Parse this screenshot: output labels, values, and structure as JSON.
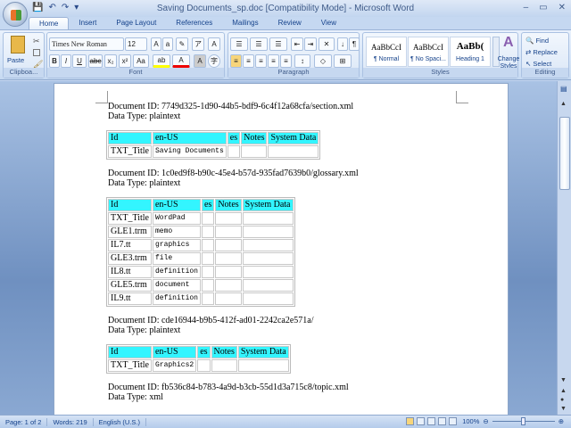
{
  "window": {
    "title": "Saving Documents_sp.doc [Compatibility Mode] - Microsoft Word",
    "minimize": "–",
    "maximize": "▭",
    "close": "✕"
  },
  "qat": {
    "save": "💾",
    "undo": "↶",
    "redo": "↷",
    "more": "▾"
  },
  "tabs": [
    "Home",
    "Insert",
    "Page Layout",
    "References",
    "Mailings",
    "Review",
    "View"
  ],
  "ribbon": {
    "clipboard": {
      "label": "Clipboa...",
      "paste": "Paste"
    },
    "font": {
      "label": "Font",
      "font_name": "Times New Roman",
      "font_size": "12",
      "bold": "B",
      "italic": "I",
      "underline": "U",
      "strike": "abc",
      "sub": "x₂",
      "sup": "x²",
      "case": "Aa"
    },
    "paragraph": {
      "label": "Paragraph"
    },
    "styles": {
      "label": "Styles",
      "items": [
        {
          "preview": "AaBbCcI",
          "name": "¶ Normal"
        },
        {
          "preview": "AaBbCcI",
          "name": "¶ No Spaci..."
        },
        {
          "preview": "AaBb(",
          "name": "Heading 1"
        }
      ],
      "change": "Change Styles"
    },
    "editing": {
      "label": "Editing",
      "find": "Find",
      "replace": "Replace",
      "select": "Select"
    }
  },
  "document": {
    "sections": [
      {
        "id_line": "Document ID: 7749d325-1d90-44b5-bdf9-6c4f12a68cfa/section.xml",
        "type_line": "Data Type: plaintext",
        "headers": [
          "Id",
          "en-US",
          "es",
          "Notes",
          "System Data"
        ],
        "rows": [
          [
            "TXT_Title",
            "Saving Documents"
          ]
        ]
      },
      {
        "id_line": "Document ID: 1c0ed9f8-b90c-45e4-b57d-935fad7639b0/glossary.xml",
        "type_line": "Data Type: plaintext",
        "headers": [
          "Id",
          "en-US",
          "es",
          "Notes",
          "System Data"
        ],
        "rows": [
          [
            "TXT_Title",
            "WordPad"
          ],
          [
            "GLE1.trm",
            "memo"
          ],
          [
            "IL7.tt",
            "graphics"
          ],
          [
            "GLE3.trm",
            "file"
          ],
          [
            "IL8.tt",
            "definition"
          ],
          [
            "GLE5.trm",
            "document"
          ],
          [
            "IL9.tt",
            "definition"
          ]
        ]
      },
      {
        "id_line": "Document ID: cde16944-b9b5-412f-ad01-2242ca2e571a/",
        "type_line": "Data Type: plaintext",
        "headers": [
          "Id",
          "en-US",
          "es",
          "Notes",
          "System Data"
        ],
        "rows": [
          [
            "TXT_Title",
            "Graphics2"
          ]
        ]
      },
      {
        "id_line": "Document ID: fb536c84-b783-4a9d-b3cb-55d1d3a715c8/topic.xml",
        "type_line": "Data Type: xml"
      }
    ]
  },
  "status": {
    "page": "Page: 1 of 2",
    "words": "Words: 219",
    "language": "English (U.S.)",
    "zoom": "100%",
    "zoom_percent": 100
  },
  "colors": {
    "table_header": "#33f5ff"
  }
}
